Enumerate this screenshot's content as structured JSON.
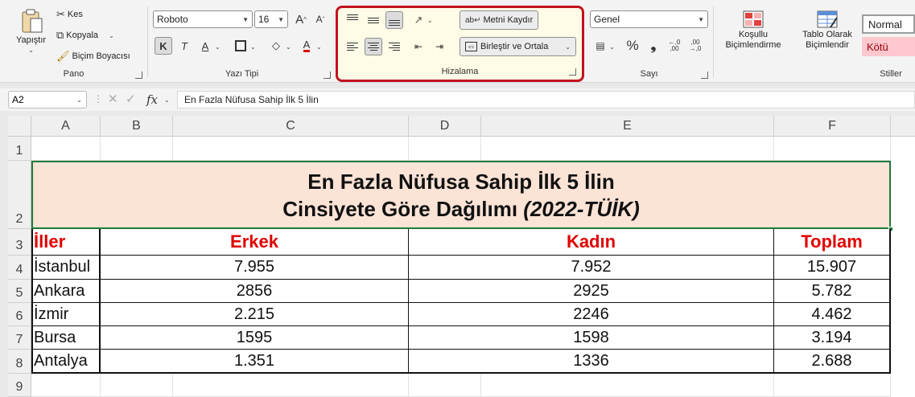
{
  "ribbon": {
    "pano": {
      "label": "Pano",
      "paste_label": "Yapıştır",
      "cut_label": "Kes",
      "copy_label": "Kopyala",
      "format_painter_label": "Biçim Boyacısı"
    },
    "font": {
      "label": "Yazı Tipi",
      "font_name": "Roboto",
      "font_size": "16",
      "bold": "K",
      "italic": "T",
      "underline": "A",
      "font_color_letter": "A",
      "grow": "A",
      "shrink": "A"
    },
    "alignment": {
      "label": "Hizalama",
      "wrap_text_label": "Metni Kaydır",
      "merge_center_label": "Birleştir ve Ortala"
    },
    "number": {
      "label": "Sayı",
      "format": "Genel",
      "percent": "%",
      "comma": "❟",
      "inc_decimal": "←,0\n,00",
      "dec_decimal": ",00\n→,0"
    },
    "styles": {
      "label": "Stiller",
      "conditional_label_line1": "Koşullu",
      "conditional_label_line2": "Biçimlendirme",
      "table_label_line1": "Tablo Olarak",
      "table_label_line2": "Biçimlendir",
      "normal_style": "Normal",
      "bad_style": "Kötü"
    },
    "highlight_color": "#c1121f"
  },
  "formula_bar": {
    "name_box": "A2",
    "fx": "fx",
    "content": "En Fazla Nüfusa Sahip İlk 5 İlin"
  },
  "sheet": {
    "columns": [
      "A",
      "B",
      "C",
      "D",
      "E",
      "F"
    ],
    "rows": [
      "1",
      "2",
      "3",
      "4",
      "5",
      "6",
      "7",
      "8",
      "9"
    ],
    "title_line1": "En Fazla Nüfusa Sahip İlk 5 İlin",
    "title_line2_normal": "Cinsiyete Göre Dağılımı ",
    "title_line2_italic": "(2022-TÜİK)",
    "headers": {
      "city": "İller",
      "male": "Erkek",
      "female": "Kadın",
      "total": "Toplam"
    },
    "data": [
      {
        "city": "İstanbul",
        "male": "7.955",
        "female": "7.952",
        "total": "15.907"
      },
      {
        "city": "Ankara",
        "male": "2856",
        "female": "2925",
        "total": "5.782"
      },
      {
        "city": "İzmir",
        "male": "2.215",
        "female": "2246",
        "total": "4.462"
      },
      {
        "city": "Bursa",
        "male": "1595",
        "female": "1598",
        "total": "3.194"
      },
      {
        "city": "Antalya",
        "male": "1.351",
        "female": "1336",
        "total": "2.688"
      }
    ],
    "title_fill": "#fbe3d6",
    "header_text_color": "#e00000",
    "selection_color": "#1f7a3a"
  }
}
